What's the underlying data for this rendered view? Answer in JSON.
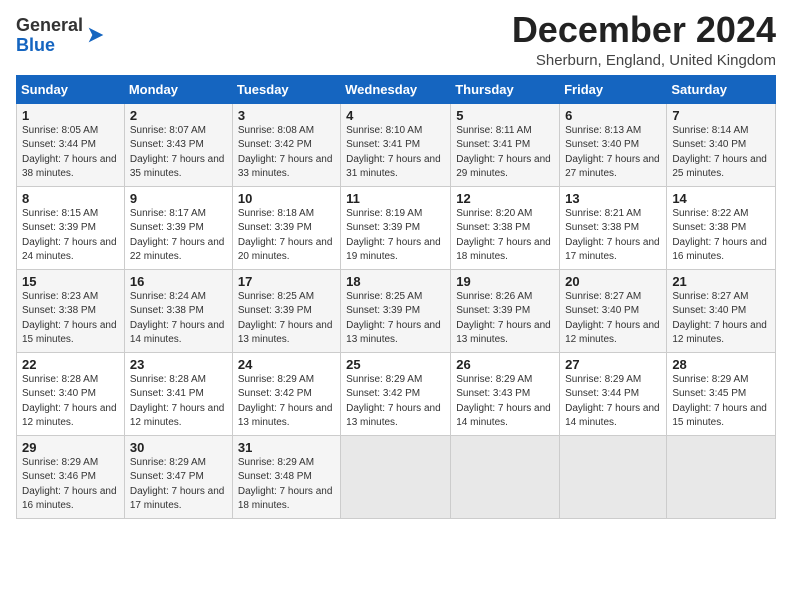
{
  "header": {
    "logo_general": "General",
    "logo_blue": "Blue",
    "month_title": "December 2024",
    "location": "Sherburn, England, United Kingdom"
  },
  "days_of_week": [
    "Sunday",
    "Monday",
    "Tuesday",
    "Wednesday",
    "Thursday",
    "Friday",
    "Saturday"
  ],
  "weeks": [
    [
      {
        "day": "1",
        "sunrise": "Sunrise: 8:05 AM",
        "sunset": "Sunset: 3:44 PM",
        "daylight": "Daylight: 7 hours and 38 minutes."
      },
      {
        "day": "2",
        "sunrise": "Sunrise: 8:07 AM",
        "sunset": "Sunset: 3:43 PM",
        "daylight": "Daylight: 7 hours and 35 minutes."
      },
      {
        "day": "3",
        "sunrise": "Sunrise: 8:08 AM",
        "sunset": "Sunset: 3:42 PM",
        "daylight": "Daylight: 7 hours and 33 minutes."
      },
      {
        "day": "4",
        "sunrise": "Sunrise: 8:10 AM",
        "sunset": "Sunset: 3:41 PM",
        "daylight": "Daylight: 7 hours and 31 minutes."
      },
      {
        "day": "5",
        "sunrise": "Sunrise: 8:11 AM",
        "sunset": "Sunset: 3:41 PM",
        "daylight": "Daylight: 7 hours and 29 minutes."
      },
      {
        "day": "6",
        "sunrise": "Sunrise: 8:13 AM",
        "sunset": "Sunset: 3:40 PM",
        "daylight": "Daylight: 7 hours and 27 minutes."
      },
      {
        "day": "7",
        "sunrise": "Sunrise: 8:14 AM",
        "sunset": "Sunset: 3:40 PM",
        "daylight": "Daylight: 7 hours and 25 minutes."
      }
    ],
    [
      {
        "day": "8",
        "sunrise": "Sunrise: 8:15 AM",
        "sunset": "Sunset: 3:39 PM",
        "daylight": "Daylight: 7 hours and 24 minutes."
      },
      {
        "day": "9",
        "sunrise": "Sunrise: 8:17 AM",
        "sunset": "Sunset: 3:39 PM",
        "daylight": "Daylight: 7 hours and 22 minutes."
      },
      {
        "day": "10",
        "sunrise": "Sunrise: 8:18 AM",
        "sunset": "Sunset: 3:39 PM",
        "daylight": "Daylight: 7 hours and 20 minutes."
      },
      {
        "day": "11",
        "sunrise": "Sunrise: 8:19 AM",
        "sunset": "Sunset: 3:39 PM",
        "daylight": "Daylight: 7 hours and 19 minutes."
      },
      {
        "day": "12",
        "sunrise": "Sunrise: 8:20 AM",
        "sunset": "Sunset: 3:38 PM",
        "daylight": "Daylight: 7 hours and 18 minutes."
      },
      {
        "day": "13",
        "sunrise": "Sunrise: 8:21 AM",
        "sunset": "Sunset: 3:38 PM",
        "daylight": "Daylight: 7 hours and 17 minutes."
      },
      {
        "day": "14",
        "sunrise": "Sunrise: 8:22 AM",
        "sunset": "Sunset: 3:38 PM",
        "daylight": "Daylight: 7 hours and 16 minutes."
      }
    ],
    [
      {
        "day": "15",
        "sunrise": "Sunrise: 8:23 AM",
        "sunset": "Sunset: 3:38 PM",
        "daylight": "Daylight: 7 hours and 15 minutes."
      },
      {
        "day": "16",
        "sunrise": "Sunrise: 8:24 AM",
        "sunset": "Sunset: 3:38 PM",
        "daylight": "Daylight: 7 hours and 14 minutes."
      },
      {
        "day": "17",
        "sunrise": "Sunrise: 8:25 AM",
        "sunset": "Sunset: 3:39 PM",
        "daylight": "Daylight: 7 hours and 13 minutes."
      },
      {
        "day": "18",
        "sunrise": "Sunrise: 8:25 AM",
        "sunset": "Sunset: 3:39 PM",
        "daylight": "Daylight: 7 hours and 13 minutes."
      },
      {
        "day": "19",
        "sunrise": "Sunrise: 8:26 AM",
        "sunset": "Sunset: 3:39 PM",
        "daylight": "Daylight: 7 hours and 13 minutes."
      },
      {
        "day": "20",
        "sunrise": "Sunrise: 8:27 AM",
        "sunset": "Sunset: 3:40 PM",
        "daylight": "Daylight: 7 hours and 12 minutes."
      },
      {
        "day": "21",
        "sunrise": "Sunrise: 8:27 AM",
        "sunset": "Sunset: 3:40 PM",
        "daylight": "Daylight: 7 hours and 12 minutes."
      }
    ],
    [
      {
        "day": "22",
        "sunrise": "Sunrise: 8:28 AM",
        "sunset": "Sunset: 3:40 PM",
        "daylight": "Daylight: 7 hours and 12 minutes."
      },
      {
        "day": "23",
        "sunrise": "Sunrise: 8:28 AM",
        "sunset": "Sunset: 3:41 PM",
        "daylight": "Daylight: 7 hours and 12 minutes."
      },
      {
        "day": "24",
        "sunrise": "Sunrise: 8:29 AM",
        "sunset": "Sunset: 3:42 PM",
        "daylight": "Daylight: 7 hours and 13 minutes."
      },
      {
        "day": "25",
        "sunrise": "Sunrise: 8:29 AM",
        "sunset": "Sunset: 3:42 PM",
        "daylight": "Daylight: 7 hours and 13 minutes."
      },
      {
        "day": "26",
        "sunrise": "Sunrise: 8:29 AM",
        "sunset": "Sunset: 3:43 PM",
        "daylight": "Daylight: 7 hours and 14 minutes."
      },
      {
        "day": "27",
        "sunrise": "Sunrise: 8:29 AM",
        "sunset": "Sunset: 3:44 PM",
        "daylight": "Daylight: 7 hours and 14 minutes."
      },
      {
        "day": "28",
        "sunrise": "Sunrise: 8:29 AM",
        "sunset": "Sunset: 3:45 PM",
        "daylight": "Daylight: 7 hours and 15 minutes."
      }
    ],
    [
      {
        "day": "29",
        "sunrise": "Sunrise: 8:29 AM",
        "sunset": "Sunset: 3:46 PM",
        "daylight": "Daylight: 7 hours and 16 minutes."
      },
      {
        "day": "30",
        "sunrise": "Sunrise: 8:29 AM",
        "sunset": "Sunset: 3:47 PM",
        "daylight": "Daylight: 7 hours and 17 minutes."
      },
      {
        "day": "31",
        "sunrise": "Sunrise: 8:29 AM",
        "sunset": "Sunset: 3:48 PM",
        "daylight": "Daylight: 7 hours and 18 minutes."
      },
      null,
      null,
      null,
      null
    ]
  ]
}
